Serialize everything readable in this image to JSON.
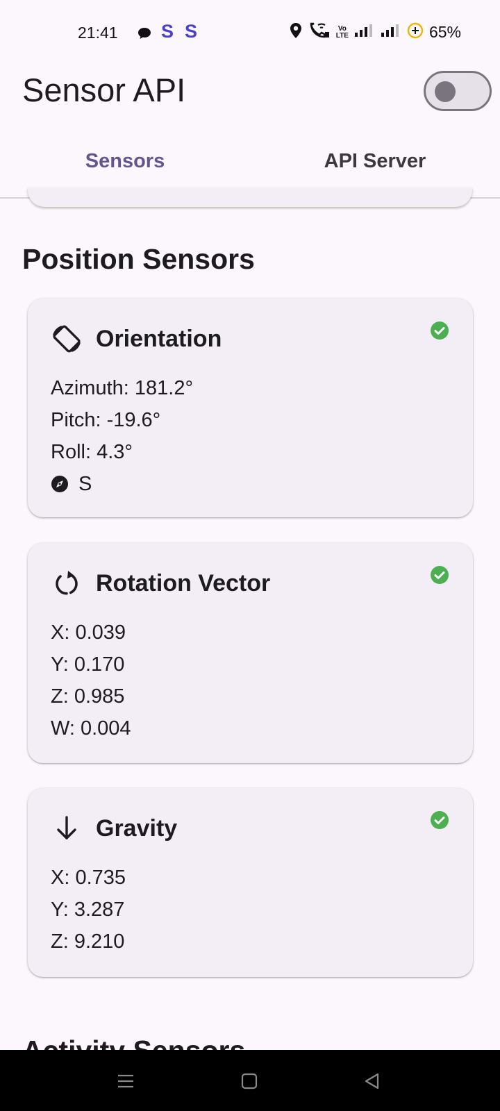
{
  "status_bar": {
    "time": "21:41",
    "s_icon_1": "S",
    "s_icon_2": "S",
    "volte_top": "Vo",
    "volte_bottom": "LTE",
    "battery": "65%",
    "icons": [
      "chat-icon",
      "location-icon",
      "wifi-call-icon",
      "signal-icon",
      "battery-saver-icon"
    ]
  },
  "app_bar": {
    "title": "Sensor API",
    "toggle_state": "off"
  },
  "tabs": [
    {
      "label": "Sensors",
      "selected": true
    },
    {
      "label": "API Server",
      "selected": false
    }
  ],
  "sections": {
    "position_title": "Position Sensors",
    "next_title": "Activity Sensors"
  },
  "cards": {
    "orientation": {
      "title": "Orientation",
      "icon": "screen-rotation-icon",
      "status": "check-circle-icon",
      "lines": [
        "Azimuth: 181.2°",
        "Pitch: -19.6°",
        "Roll: 4.3°"
      ],
      "direction": "S"
    },
    "rotation_vector": {
      "title": "Rotation Vector",
      "icon": "rotate-icon",
      "status": "check-circle-icon",
      "lines": [
        "X: 0.039",
        "Y: 0.170",
        "Z: 0.985",
        "W: 0.004"
      ]
    },
    "gravity": {
      "title": "Gravity",
      "icon": "arrow-down-icon",
      "status": "check-circle-icon",
      "lines": [
        "X: 0.735",
        "Y: 3.287",
        "Z: 9.210"
      ]
    }
  },
  "colors": {
    "primary": "#65558f",
    "success": "#4caf50",
    "background": "#fcf7fc",
    "card": "#f3eef5"
  }
}
